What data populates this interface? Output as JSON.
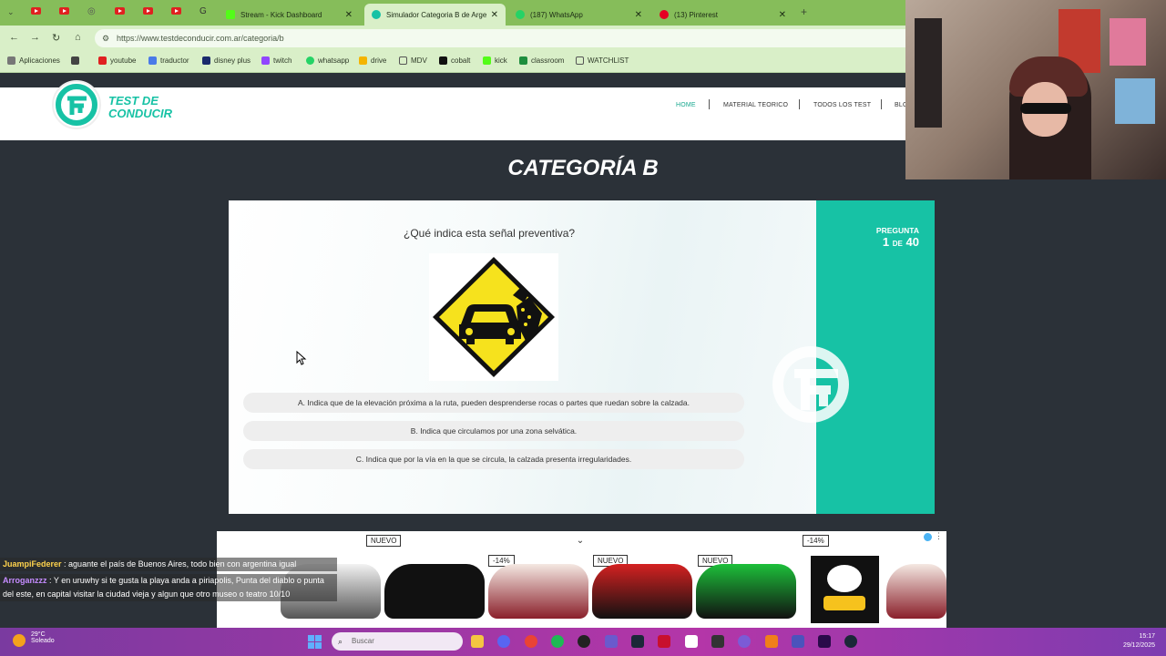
{
  "browser": {
    "tabs": [
      {
        "label": "Stream - Kick Dashboard",
        "color": "#53fc18"
      },
      {
        "label": "Simulador Categoria B de Arge",
        "color": "#17c2a5",
        "active": true
      },
      {
        "label": "(187) WhatsApp",
        "color": "#25d366"
      },
      {
        "label": "(13) Pinterest",
        "color": "#e60023"
      }
    ],
    "url": "https://www.testdeconducir.com.ar/categoria/b",
    "bookmarks": [
      "Aplicaciones",
      "youtube",
      "traductor",
      "disney plus",
      "twitch",
      "whatsapp",
      "drive",
      "MDV",
      "cobalt",
      "kick",
      "classroom",
      "WATCHLIST"
    ]
  },
  "site": {
    "logo_line1": "TEST DE",
    "logo_line2": "CONDUCIR",
    "nav": [
      "HOME",
      "MATERIAL TEORICO",
      "TODOS LOS TEST",
      "BLO"
    ],
    "page_title": "CATEGORÍA B",
    "brand_color": "#17c2a5"
  },
  "quiz": {
    "question": "¿Qué indica esta señal preventiva?",
    "options": [
      "A. Indica que de la elevación próxima a la ruta, pueden desprenderse rocas o partes que ruedan sobre la calzada.",
      "B. Indica que circulamos por una zona selvática.",
      "C. Indica que por la vía en la que se circula, la calzada presenta irregularidades."
    ],
    "progress_label": "PREGUNTA",
    "progress_current": "1",
    "progress_de": "DE",
    "progress_total": "40"
  },
  "ad": {
    "badges": [
      "NUEVO",
      "-14%",
      "NUEVO",
      "NUEVO",
      "-14%"
    ]
  },
  "chat": [
    {
      "user": "JuampiFederer",
      "text": ": aguante el país de Buenos Aires, todo bien con argentina igual"
    },
    {
      "user": "Arroganzzz",
      "text": ": Y en uruwhy si te gusta la playa anda a piriapolis, Punta del diablo o punta del este, en capital visitar la ciudad vieja y algun que otro museo o teatro 10/10"
    }
  ],
  "taskbar": {
    "weather_temp": "29°C",
    "weather_desc": "Soleado",
    "search_placeholder": "Buscar",
    "time": "15:17",
    "date": "29/12/2025"
  }
}
